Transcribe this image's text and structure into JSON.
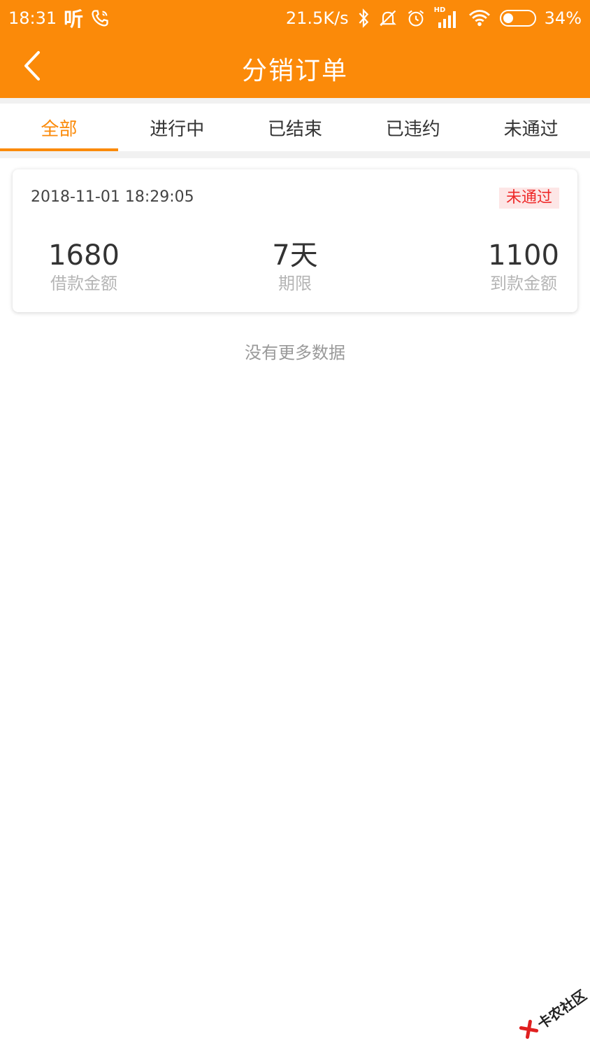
{
  "status_bar": {
    "time": "18:31",
    "listen_label": "听",
    "net_speed": "21.5K/s",
    "signal_hd": "HD",
    "battery_level": 0.34,
    "battery_text": "34%"
  },
  "header": {
    "title": "分销订单",
    "background": "#fb8a09"
  },
  "tabs": [
    {
      "label": "全部",
      "active": true
    },
    {
      "label": "进行中",
      "active": false
    },
    {
      "label": "已结束",
      "active": false
    },
    {
      "label": "已违约",
      "active": false
    },
    {
      "label": "未通过",
      "active": false
    }
  ],
  "orders": [
    {
      "datetime": "2018-11-01 18:29:05",
      "status": "未通过",
      "loan_amount": "1680",
      "loan_amount_label": "借款金额",
      "term": "7天",
      "term_label": "期限",
      "received_amount": "1100",
      "received_amount_label": "到款金额"
    }
  ],
  "footer_text": "没有更多数据",
  "watermark": "卡农社区",
  "colors": {
    "accent": "#fb8a09",
    "status_red": "#ee2a2a",
    "status_red_bg": "#fde6e6"
  }
}
